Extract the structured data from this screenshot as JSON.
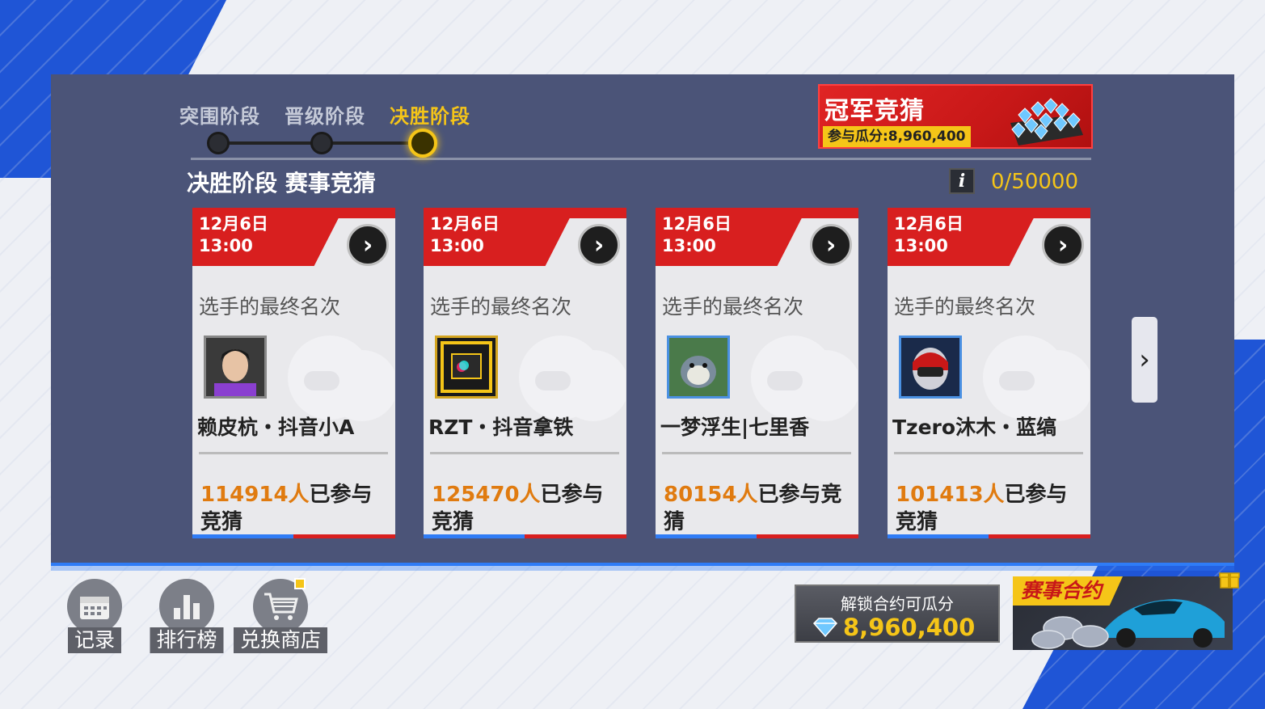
{
  "stages": {
    "items": [
      {
        "label": "突围阶段",
        "active": false
      },
      {
        "label": "晋级阶段",
        "active": false
      },
      {
        "label": "决胜阶段",
        "active": true
      }
    ]
  },
  "section": {
    "title": "决胜阶段 赛事竞猜",
    "info_label": "i",
    "counter": "0/50000"
  },
  "champion": {
    "title": "冠军竞猜",
    "subtitle": "参与瓜分:8,960,400"
  },
  "cards": [
    {
      "date": "12月6日",
      "time": "13:00",
      "subtitle": "选手的最终名次",
      "name": "赖皮杭・抖音小A",
      "count": "114914人",
      "count_suffix": "已参与竞猜"
    },
    {
      "date": "12月6日",
      "time": "13:00",
      "subtitle": "选手的最终名次",
      "name": "RZT・抖音拿铁",
      "count": "125470人",
      "count_suffix": "已参与竞猜"
    },
    {
      "date": "12月6日",
      "time": "13:00",
      "subtitle": "选手的最终名次",
      "name": "一梦浮生|七里香",
      "count": "80154人",
      "count_suffix": "已参与竞猜"
    },
    {
      "date": "12月6日",
      "time": "13:00",
      "subtitle": "选手的最终名次",
      "name": "Tzero沐木・蓝缟",
      "count": "101413人",
      "count_suffix": "已参与竞猜"
    }
  ],
  "bottom_nav": {
    "record": "记录",
    "ranking": "排行榜",
    "shop": "兑换商店"
  },
  "contract": {
    "label": "解锁合约可瓜分",
    "value": "8,960,400",
    "card_title": "赛事合约"
  },
  "colors": {
    "accent_red": "#d81f1f",
    "accent_gold": "#f5c518",
    "accent_blue": "#2f7cf6",
    "count_orange": "#e07b10"
  },
  "icons": {
    "arrow": "chevron-right-icon",
    "record": "calendar-icon",
    "ranking": "bar-chart-icon",
    "shop": "shopping-cart-icon",
    "gem": "diamond-icon",
    "gift": "gift-icon"
  }
}
